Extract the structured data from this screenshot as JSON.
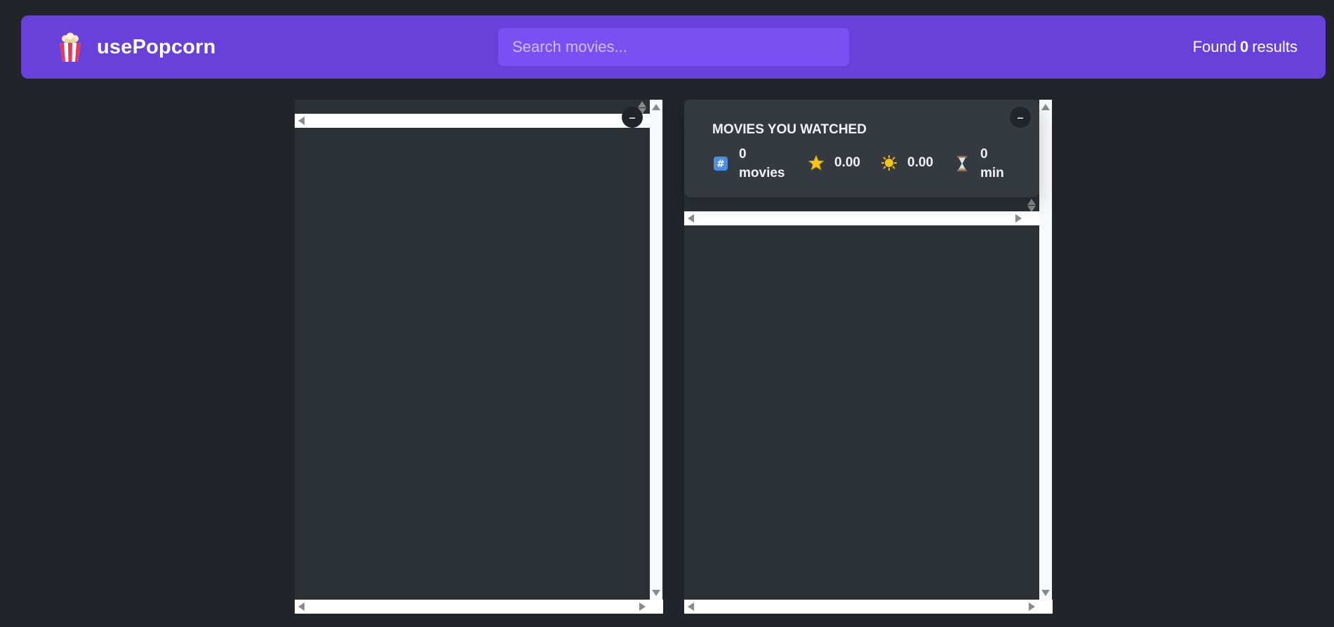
{
  "nav": {
    "logo_text": "usePopcorn",
    "search_placeholder": "Search movies...",
    "results_prefix": "Found",
    "results_count": "0",
    "results_suffix": "results"
  },
  "summary": {
    "title": "Movies you watched",
    "movies_count": "0",
    "movies_label": "movies",
    "avg_imdb": "0.00",
    "avg_user": "0.00",
    "runtime": "0",
    "runtime_label": "min"
  },
  "toggle_symbol": "–",
  "colors": {
    "background": "#212529",
    "nav": "#6741d9",
    "search": "#7950f2",
    "box": "#2b3035",
    "summary": "#343a40"
  }
}
